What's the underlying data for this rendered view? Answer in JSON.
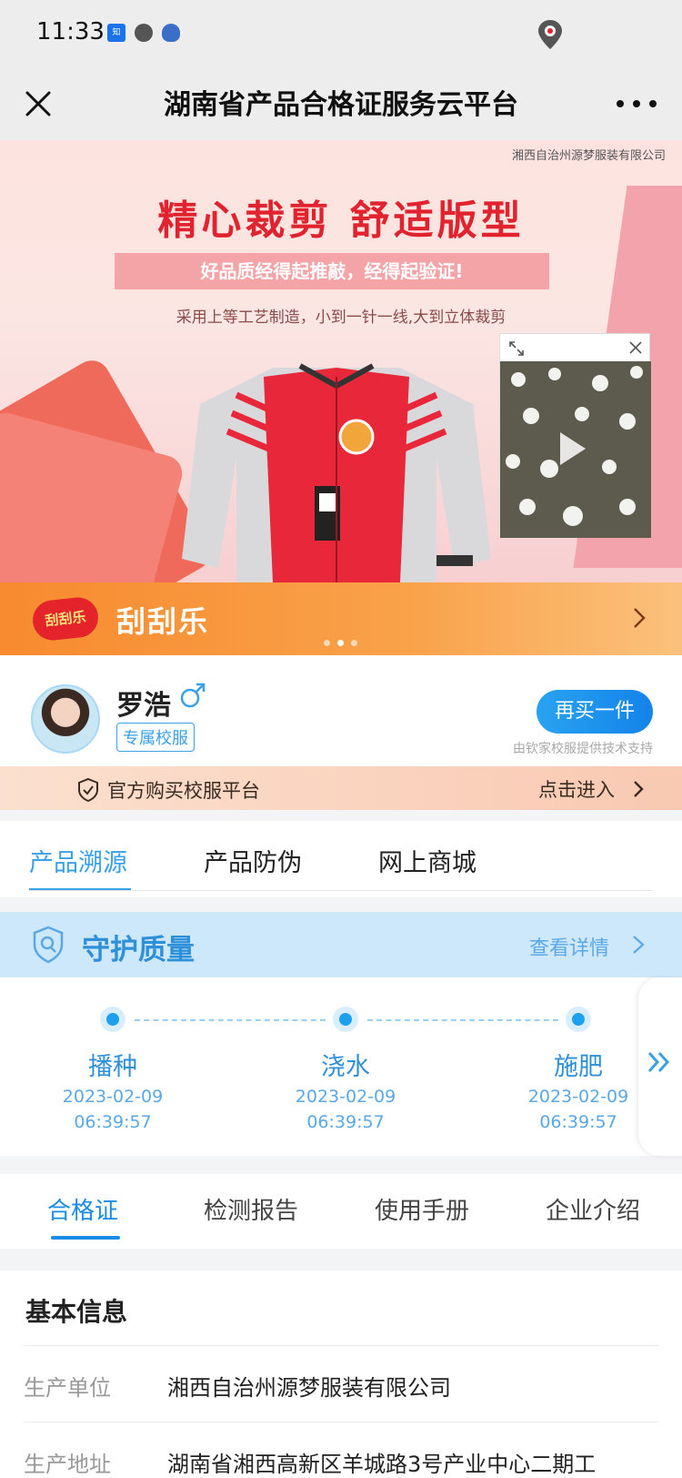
{
  "status_bar": {
    "time": "11:33"
  },
  "nav": {
    "title": "湖南省产品合格证服务云平台"
  },
  "banner": {
    "company": "湘西自治州源梦服装有限公司",
    "slogan": "精心裁剪  舒适版型",
    "tagline": "好品质经得起推敲，经得起验证!",
    "subline": "采用上等工艺制造，小到一针一线,大到立体裁剪"
  },
  "promo": {
    "logo_text": "刮刮乐",
    "label": "刮刮乐"
  },
  "profile": {
    "name": "罗浩",
    "tag": "专属校服",
    "buy_label": "再买一件",
    "support": "由钦家校服提供技术支持"
  },
  "official": {
    "text": "官方购买校服平台",
    "enter": "点击进入"
  },
  "tabs_top": [
    "产品溯源",
    "产品防伪",
    "网上商城"
  ],
  "quality": {
    "title": "守护质量",
    "more": "查看详情"
  },
  "timeline": [
    {
      "name": "播种",
      "date": "2023-02-09",
      "time": "06:39:57"
    },
    {
      "name": "浇水",
      "date": "2023-02-09",
      "time": "06:39:57"
    },
    {
      "name": "施肥",
      "date": "2023-02-09",
      "time": "06:39:57"
    }
  ],
  "tabs_bottom": [
    "合格证",
    "检测报告",
    "使用手册",
    "企业介绍"
  ],
  "basic_info": {
    "heading": "基本信息",
    "rows": [
      {
        "key": "生产单位",
        "value": "湘西自治州源梦服装有限公司"
      },
      {
        "key": "生产地址",
        "value": "湖南省湘西高新区羊城路3号产业中心二期工"
      }
    ]
  },
  "colors": {
    "accent": "#1a8be8",
    "promo": "#f88a2f",
    "slogan": "#e0232e"
  }
}
